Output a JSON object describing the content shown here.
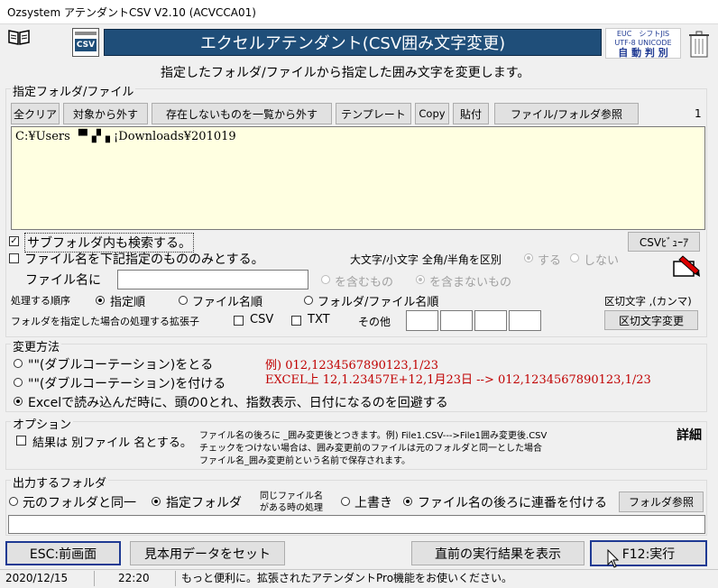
{
  "window": {
    "title": "Ozsystem アテンダントCSV V2.10 (ACVCCA01)"
  },
  "header": {
    "banner_title": "エクセルアテンダント(CSV囲み文字変更)",
    "csv_icon_label": "CSV",
    "encoding_badge": {
      "line1": "EUC　シフトJIS",
      "line2": "UTF-8 UNICODE",
      "line3": "自 動 判 別"
    },
    "subtitle": "指定したフォルダ/ファイルから指定した囲み文字を変更します。"
  },
  "folder_group": {
    "label": "指定フォルダ/ファイル",
    "buttons": {
      "clear_all": "全クリア",
      "remove": "対象から外す",
      "remove_missing": "存在しないものを一覧から外す",
      "template": "テンプレート",
      "copy": "Copy",
      "paste": "貼付",
      "browse": "ファイル/フォルダ参照"
    },
    "count": "1",
    "list_items": [
      "C:¥Users ▝▘▞▗ ¡Downloads¥201019"
    ],
    "subfolder_search": "サブフォルダ内も検索する。",
    "csv_viewer": "CSVﾋﾞｭｰｱ",
    "filename_only": "ファイル名を下記指定のもののみとする。",
    "case_label": "大文字/小文字 全角/半角を区別",
    "case_yes": "する",
    "case_no": "しない",
    "filename_label": "ファイル名に",
    "filename_value": "",
    "include": "を含むもの",
    "exclude": "を含まないもの",
    "order_label": "処理する順序",
    "order_specified": "指定順",
    "order_filename": "ファイル名順",
    "order_folder_file": "フォルダ/ファイル名順",
    "delimiter_label": "区切文字 ,(カンマ)",
    "ext_label": "フォルダを指定した場合の処理する拡張子",
    "ext_csv": "CSV",
    "ext_txt": "TXT",
    "ext_other": "その他",
    "delimiter_change": "区切文字変更"
  },
  "method_group": {
    "label": "変更方法",
    "opt1": "\"\"(ダブルコーテーション)をとる",
    "opt2": "\"\"(ダブルコーテーション)を付ける",
    "opt3": "Excelで読み込んだ時に、頭の0とれ、指数表示、日付になるのを回避する",
    "example1": "例) 012,1234567890123,1/23",
    "example2": "EXCEL上 12,1.23457E+12,1月23日 --> 012,1234567890123,1/23"
  },
  "option_group": {
    "label": "オプション",
    "separate_file": "結果は 別ファイル 名とする。",
    "note1": "ファイル名の後ろに _囲み変更後とつきます。例) File1.CSV--->File1囲み変更後.CSV",
    "note2": "チェックをつけない場合は、囲み変更前のファイルは元のフォルダと同一とした場合",
    "note3": "ファイル名_囲み変更前という名前で保存されます。",
    "detail": "詳細"
  },
  "output_group": {
    "label": "出力するフォルダ",
    "same_folder": "元のフォルダと同一",
    "specified_folder": "指定フォルダ",
    "same_name_line1": "同じファイル名",
    "same_name_line2": "がある時の処理",
    "overwrite": "上書き",
    "sequence": "ファイル名の後ろに連番を付ける",
    "browse": "フォルダ参照",
    "path_value": ""
  },
  "footer_buttons": {
    "esc": "ESC:前画面",
    "sample": "見本用データをセット",
    "last_result": "直前の実行結果を表示",
    "run": "F12:実行"
  },
  "status": {
    "date": "2020/12/15",
    "time": "22:20",
    "message": "もっと便利に。拡張されたアテンダントPro機能をお使いください。"
  }
}
